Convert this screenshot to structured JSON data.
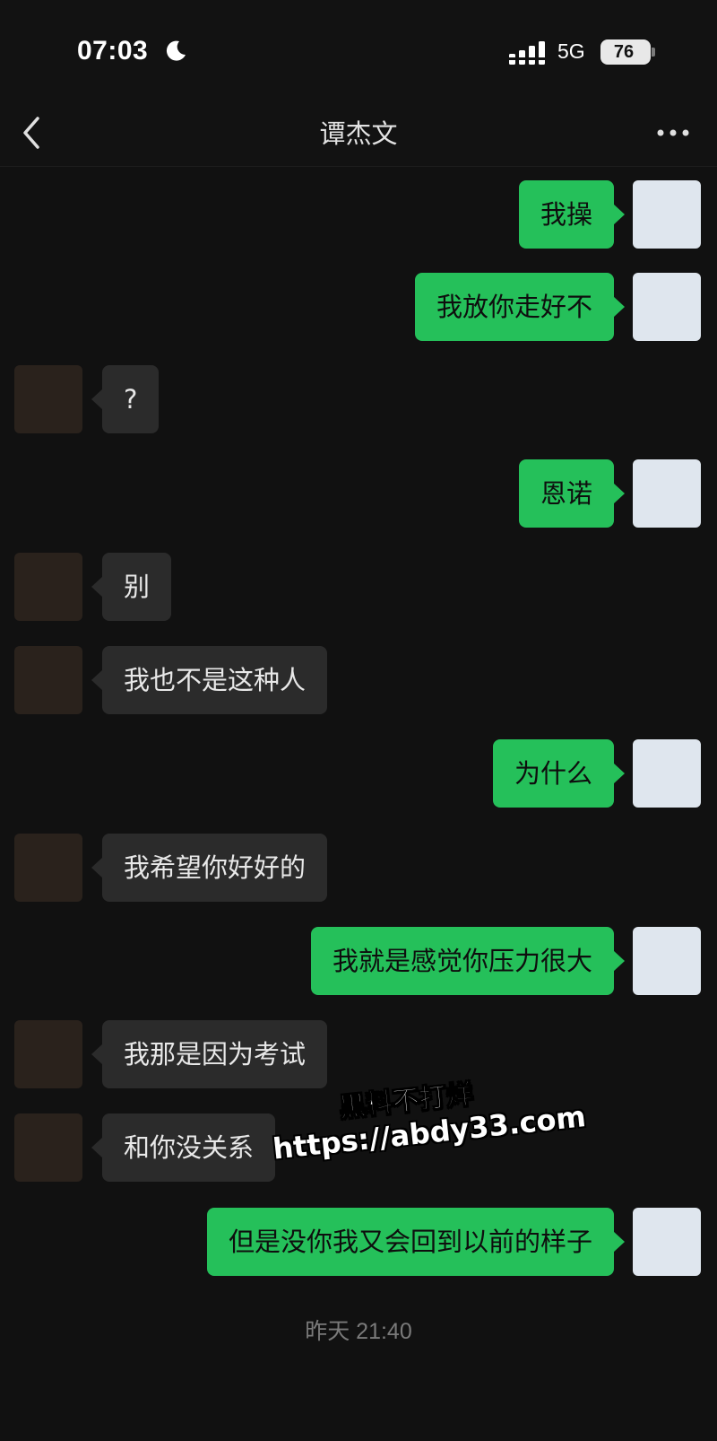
{
  "status_bar": {
    "time": "07:03",
    "network": "5G",
    "battery": "76",
    "icons": [
      "moon-icon",
      "signal-icon",
      "battery-icon"
    ]
  },
  "header": {
    "title": "谭杰文",
    "back_icon": "chevron-left-icon",
    "more_icon": "ellipsis-icon"
  },
  "messages": [
    {
      "side": "out",
      "text": "我操"
    },
    {
      "side": "out",
      "text": "我放你走好不"
    },
    {
      "side": "in",
      "text": "?"
    },
    {
      "side": "out",
      "text": "恩诺"
    },
    {
      "side": "in",
      "text": "别"
    },
    {
      "side": "in",
      "text": "我也不是这种人"
    },
    {
      "side": "out",
      "text": "为什么"
    },
    {
      "side": "in",
      "text": "我希望你好好的"
    },
    {
      "side": "out",
      "text": "我就是感觉你压力很大"
    },
    {
      "side": "in",
      "text": "我那是因为考试"
    },
    {
      "side": "in",
      "text": "和你没关系"
    },
    {
      "side": "out",
      "text": "但是没你我又会回到以前的样子"
    }
  ],
  "timestamp": "昨天 21:40",
  "watermark": {
    "line1": "黑料不打烊",
    "line2": "https://abdy33.com"
  },
  "colors": {
    "background": "#111111",
    "outgoing_bubble": "#25c05a",
    "incoming_bubble": "#2b2b2b",
    "timestamp_text": "#7a7a7a"
  }
}
